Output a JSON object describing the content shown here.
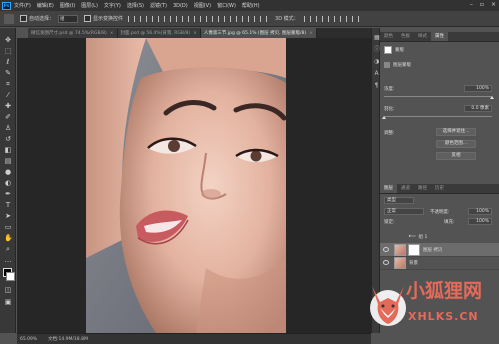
{
  "app": {
    "logo": "Ps",
    "menu": [
      "文件(F)",
      "编辑(E)",
      "图像(I)",
      "图层(L)",
      "文字(Y)",
      "选择(S)",
      "滤镜(T)",
      "3D(D)",
      "视图(V)",
      "窗口(W)",
      "帮助(H)"
    ],
    "window_controls": [
      "–",
      "▫",
      "×"
    ]
  },
  "options_bar": {
    "auto_select_label": "自动选择：",
    "auto_select_value": "组",
    "show_transform_label": "显示变换控件",
    "mode_3d_label": "3D 模式："
  },
  "tabs": [
    {
      "label": "微信发图尺寸.psd @ 74.5%(RGB/8)",
      "active": false,
      "close": "×"
    },
    {
      "label": "封面.psd @ 56.4%(背景, RGB/8)",
      "active": false,
      "close": "×"
    },
    {
      "label": "人像第三节.jpg @ 65.1% (图层 拷贝, 图层蒙版/8)",
      "active": true,
      "close": "×"
    }
  ],
  "status_bar": {
    "zoom": "65.09%",
    "doc": "文档:14.9M/18.8M"
  },
  "properties_panel": {
    "tabs": [
      "颜色",
      "色板",
      "样式",
      "属性"
    ],
    "active_tab": "属性",
    "header_label": "蒙版",
    "mask_type_label": "图层蒙版",
    "density_label": "浓度:",
    "density_value": "100%",
    "feather_label": "羽化:",
    "feather_value": "0.0 像素",
    "adjust_label": "调整:",
    "select_subject_button": "选择并遮住...",
    "color_range_button": "颜色范围...",
    "invert_button": "反相",
    "density_fraction": 1.0,
    "feather_fraction": 0.0
  },
  "layers_panel": {
    "tabs": [
      "图层",
      "通道",
      "路径",
      "历史"
    ],
    "active_tab": "图层",
    "filter_label": "类型",
    "blend_mode": "正常",
    "opacity_label": "不透明度:",
    "opacity_value": "100%",
    "lock_label": "锁定:",
    "fill_label": "填充:",
    "fill_value": "100%",
    "layers": [
      {
        "name": "组 1",
        "type": "group",
        "selected": false
      },
      {
        "name": "图层 拷贝",
        "type": "masked",
        "selected": true
      },
      {
        "name": "背景",
        "type": "image",
        "selected": false
      }
    ]
  },
  "watermark": {
    "text": "小狐狸网",
    "url": "XHLKS.CN",
    "brand_color": "#e46a5a"
  }
}
